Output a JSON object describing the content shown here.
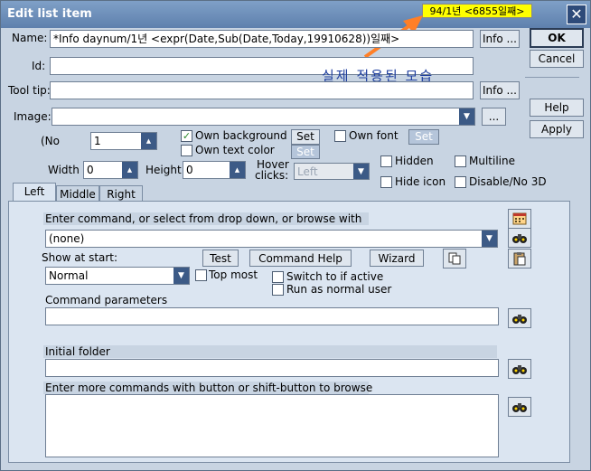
{
  "window": {
    "title": "Edit list item",
    "close_symbol": "✕"
  },
  "annotation": {
    "highlight_text": "94/1년 <6855일째>",
    "note_text": "실제 적용된 모습",
    "arrow_color": "#ff7f27"
  },
  "fields": {
    "name_label": "Name:",
    "name_value": "*Info daynum/1년 <expr(Date,Sub(Date,Today,19910628))일째>",
    "id_label": "Id:",
    "id_value": "",
    "tooltip_label": "Tool tip:",
    "tooltip_value": "",
    "image_label": "Image:",
    "image_value": "",
    "no_label": "(No",
    "no_value": "1",
    "width_label": "Width",
    "width_value": "0",
    "height_label": "Height",
    "height_value": "0",
    "hover_label_1": "Hover",
    "hover_label_2": "clicks:",
    "hover_value": "Left"
  },
  "buttons": {
    "info1": "Info ...",
    "info2": "Info ...",
    "browse_image": "...",
    "ok": "OK",
    "cancel": "Cancel",
    "help": "Help",
    "apply": "Apply",
    "set_bg": "Set",
    "set_text": "Set",
    "set_font": "Set",
    "test": "Test",
    "command_help": "Command Help",
    "wizard": "Wizard"
  },
  "checkboxes": {
    "own_background": {
      "label": "Own background",
      "checked": true
    },
    "own_text_color": {
      "label": "Own text color",
      "checked": false
    },
    "own_font": {
      "label": "Own font",
      "checked": false
    },
    "hidden": {
      "label": "Hidden",
      "checked": false
    },
    "multiline": {
      "label": "Multiline",
      "checked": false
    },
    "hide_icon": {
      "label": "Hide icon",
      "checked": false
    },
    "disable_no_3d": {
      "label": "Disable/No 3D",
      "checked": false
    },
    "top_most": {
      "label": "Top most",
      "checked": false
    },
    "switch_if_active": {
      "label": "Switch to if active",
      "checked": false
    },
    "run_as_normal_user": {
      "label": "Run as normal user",
      "checked": false
    }
  },
  "tabs": [
    {
      "label": "Left",
      "active": true
    },
    {
      "label": "Middle",
      "active": false
    },
    {
      "label": "Right",
      "active": false
    }
  ],
  "command": {
    "enter_label": "Enter command, or select from drop down, or browse with",
    "command_value": "(none)",
    "show_at_start_label": "Show at start:",
    "show_at_start_value": "Normal",
    "params_label": "Command parameters",
    "params_value": "",
    "initial_folder_label": "Initial folder",
    "initial_folder_value": "",
    "more_commands_label": "Enter more commands with button or shift-button to browse",
    "more_commands_value": ""
  }
}
